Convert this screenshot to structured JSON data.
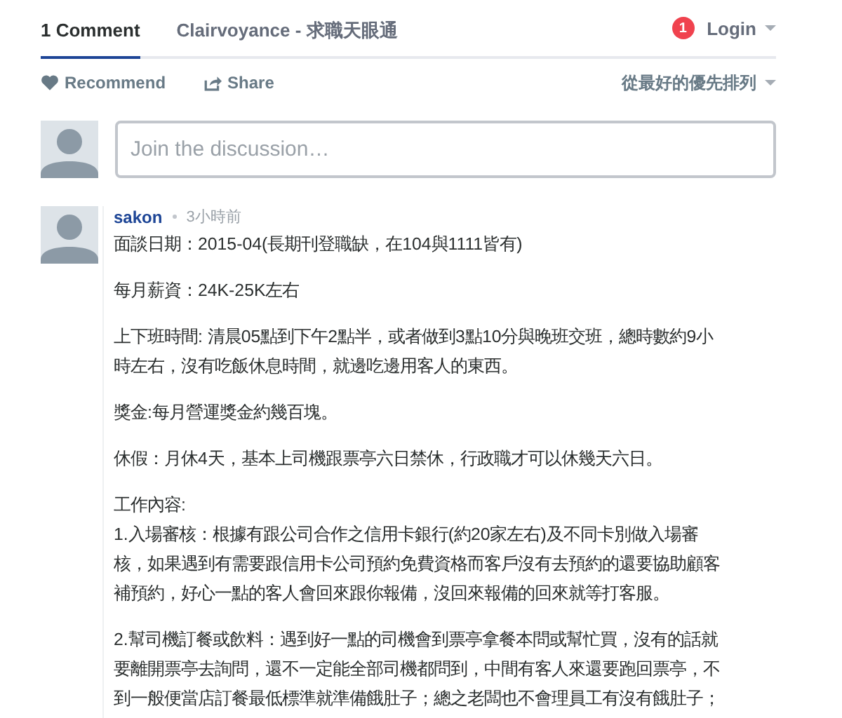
{
  "tabs": [
    {
      "label": "1 Comment",
      "selected": true
    },
    {
      "label": "Clairvoyance - 求職天眼通",
      "selected": false
    }
  ],
  "notifications": {
    "count": "1"
  },
  "login": {
    "label": "Login"
  },
  "actions": {
    "recommend": "Recommend",
    "share": "Share",
    "sort": "從最好的優先排列"
  },
  "composer": {
    "placeholder": "Join the discussion…"
  },
  "comments": [
    {
      "author": "sakon",
      "time": "3小時前",
      "paragraphs": [
        [
          "面談日期：2015-04(長期刊登職缺，在104與1111皆有)"
        ],
        [
          "每月薪資：24K-25K左右"
        ],
        [
          "上下班時間: 清晨05點到下午2點半，或者做到3點10分與晚班交班，總時數約9小",
          "時左右，沒有吃飯休息時間，就邊吃邊用客人的東西。"
        ],
        [
          "獎金:每月營運獎金約幾百塊。"
        ],
        [
          "休假：月休4天，基本上司機跟票亭六日禁休，行政職才可以休幾天六日。"
        ],
        [
          "工作內容:",
          "1.入場審核：根據有跟公司合作之信用卡銀行(約20家左右)及不同卡別做入場審",
          "核，如果遇到有需要跟信用卡公司預約免費資格而客戶沒有去預約的還要協助顧客",
          "補預約，好心一點的客人會回來跟你報備，沒回來報備的回來就等打客服。"
        ],
        [
          "2.幫司機訂餐或飲料：遇到好一點的司機會到票亭拿餐本問或幫忙買，沒有的話就",
          "要離開票亭去詢問，還不一定能全部司機都問到，中間有客人來還要跑回票亭，不",
          "到一般便當店訂餐最低標準就準備餓肚子；總之老闆也不會理員工有沒有餓肚子；"
        ]
      ]
    }
  ]
}
